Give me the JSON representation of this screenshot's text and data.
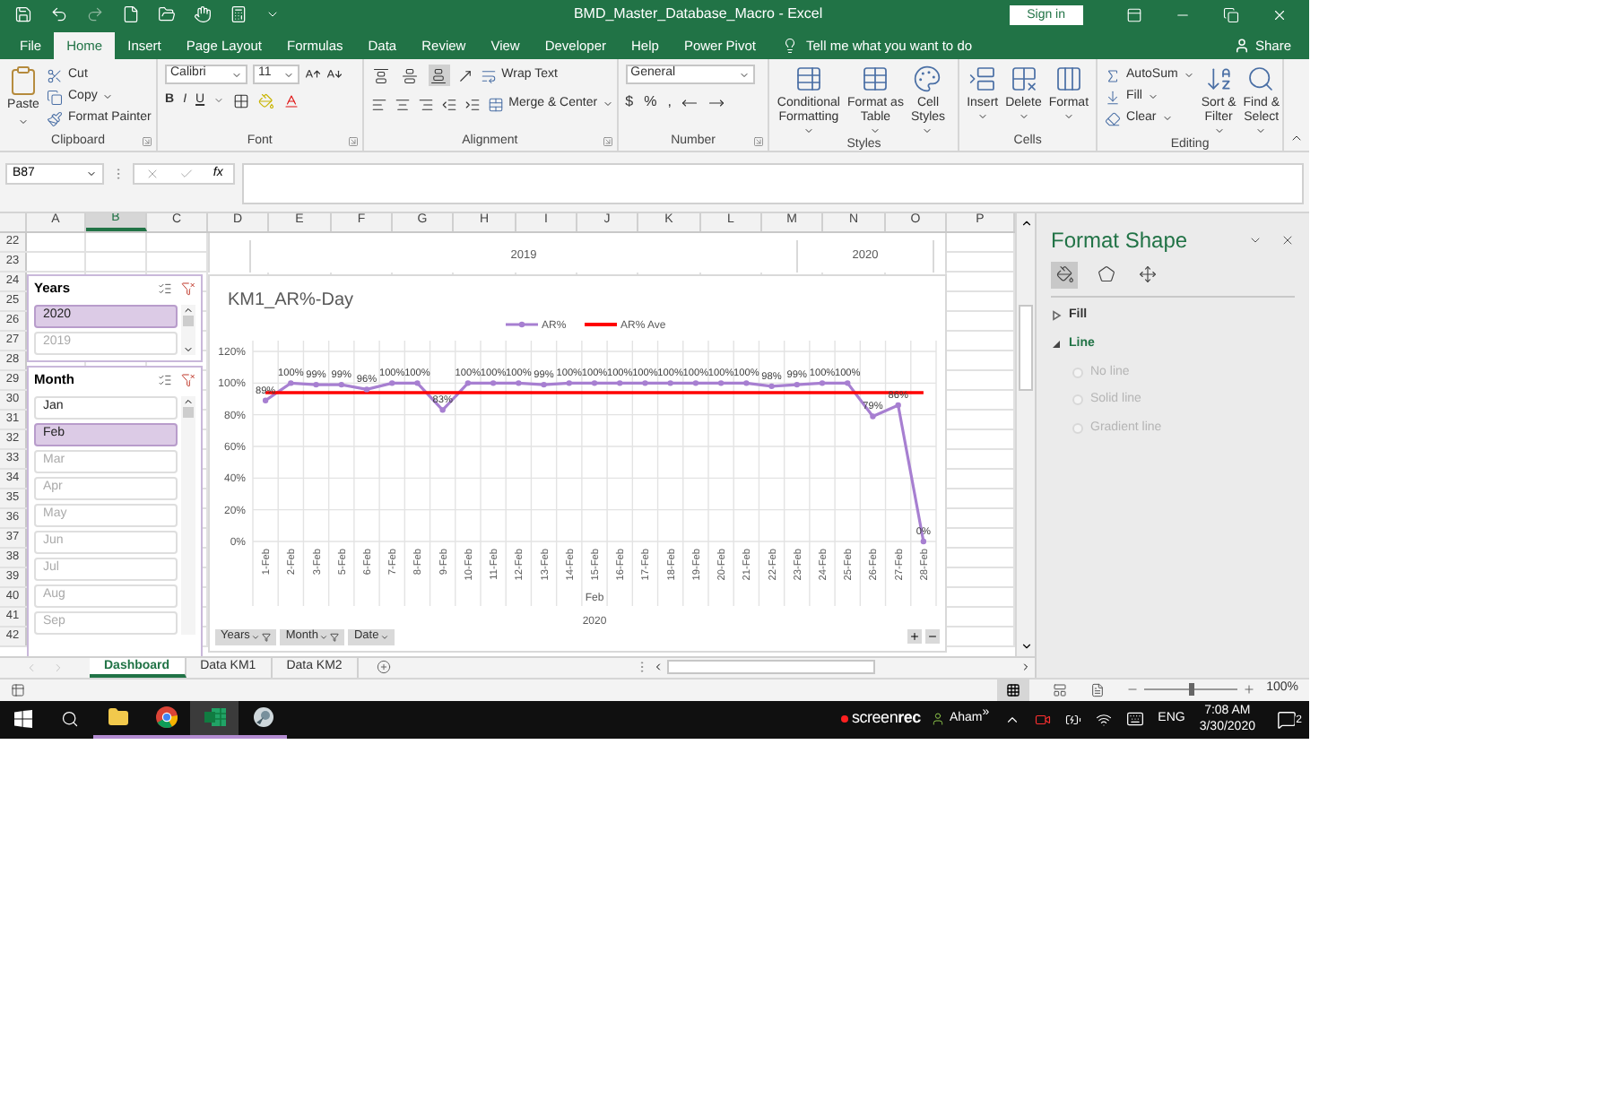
{
  "title_bar": {
    "title": "BMD_Master_Database_Macro - Excel",
    "sign_in": "Sign in"
  },
  "ribbon_tabs": [
    {
      "label": "File",
      "selected": false
    },
    {
      "label": "Home",
      "selected": true
    },
    {
      "label": "Insert",
      "selected": false
    },
    {
      "label": "Page Layout",
      "selected": false
    },
    {
      "label": "Formulas",
      "selected": false
    },
    {
      "label": "Data",
      "selected": false
    },
    {
      "label": "Review",
      "selected": false
    },
    {
      "label": "View",
      "selected": false
    },
    {
      "label": "Developer",
      "selected": false
    },
    {
      "label": "Help",
      "selected": false
    },
    {
      "label": "Power Pivot",
      "selected": false
    }
  ],
  "tell_me": "Tell me what you want to do",
  "share": "Share",
  "ribbon": {
    "clipboard": {
      "name": "Clipboard",
      "paste": "Paste",
      "cut": "Cut",
      "copy": "Copy",
      "format_painter": "Format Painter"
    },
    "font": {
      "name": "Font",
      "family": "Calibri",
      "size": "11",
      "bold": "B",
      "italic": "I",
      "underline": "U"
    },
    "alignment": {
      "name": "Alignment",
      "wrap_text": "Wrap Text",
      "merge_center": "Merge & Center",
      "valign_buttons": [
        {
          "kind": "top",
          "selected": false
        },
        {
          "kind": "middle",
          "selected": false
        },
        {
          "kind": "bottom",
          "selected": true
        }
      ]
    },
    "number": {
      "name": "Number",
      "format": "General",
      "currency": "$",
      "percent": "%",
      "comma": ","
    },
    "styles": {
      "name": "Styles",
      "buttons": [
        {
          "kind": "conditional",
          "lines": [
            "Conditional",
            "Formatting"
          ]
        },
        {
          "kind": "table",
          "lines": [
            "Format as",
            "Table"
          ]
        },
        {
          "kind": "cell_styles",
          "lines": [
            "Cell",
            "Styles"
          ]
        }
      ]
    },
    "cells": {
      "name": "Cells",
      "buttons": [
        {
          "kind": "insert",
          "lines": [
            "Insert"
          ]
        },
        {
          "kind": "delete",
          "lines": [
            "Delete"
          ]
        },
        {
          "kind": "format",
          "lines": [
            "Format"
          ]
        }
      ]
    },
    "editing": {
      "name": "Editing",
      "autosum": "AutoSum",
      "fill": "Fill",
      "clear": "Clear",
      "buttons": [
        {
          "kind": "sort",
          "lines": [
            "Sort &",
            "Filter"
          ]
        },
        {
          "kind": "find",
          "lines": [
            "Find &",
            "Select"
          ]
        }
      ]
    }
  },
  "formula_bar": {
    "name_box": "B87",
    "function_button": "fx"
  },
  "columns": [
    {
      "label": "A",
      "selected": false
    },
    {
      "label": "B",
      "selected": true
    },
    {
      "label": "C",
      "selected": false
    },
    {
      "label": "D",
      "selected": false
    },
    {
      "label": "E",
      "selected": false
    },
    {
      "label": "F",
      "selected": false
    },
    {
      "label": "G",
      "selected": false
    },
    {
      "label": "H",
      "selected": false
    },
    {
      "label": "I",
      "selected": false
    },
    {
      "label": "J",
      "selected": false
    },
    {
      "label": "K",
      "selected": false
    },
    {
      "label": "L",
      "selected": false
    },
    {
      "label": "M",
      "selected": false
    },
    {
      "label": "N",
      "selected": false
    },
    {
      "label": "O",
      "selected": false
    },
    {
      "label": "P",
      "selected": false
    }
  ],
  "rows": [
    "22",
    "23",
    "24",
    "25",
    "26",
    "27",
    "28",
    "29",
    "30",
    "31",
    "32",
    "33",
    "34",
    "35",
    "36",
    "37",
    "38",
    "39",
    "40",
    "41",
    "42"
  ],
  "chart_fragment": {
    "labels": [
      "2019",
      "2020"
    ]
  },
  "slicers": [
    {
      "title": "Years",
      "items": [
        {
          "label": "2020",
          "selected": true,
          "has_data": true
        },
        {
          "label": "2019",
          "selected": false,
          "has_data": false
        }
      ]
    },
    {
      "title": "Month",
      "items": [
        {
          "label": "Jan",
          "selected": false,
          "has_data": true
        },
        {
          "label": "Feb",
          "selected": true,
          "has_data": true
        },
        {
          "label": "Mar",
          "selected": false,
          "has_data": false
        },
        {
          "label": "Apr",
          "selected": false,
          "has_data": false
        },
        {
          "label": "May",
          "selected": false,
          "has_data": false
        },
        {
          "label": "Jun",
          "selected": false,
          "has_data": false
        },
        {
          "label": "Jul",
          "selected": false,
          "has_data": false
        },
        {
          "label": "Aug",
          "selected": false,
          "has_data": false
        },
        {
          "label": "Sep",
          "selected": false,
          "has_data": false
        }
      ]
    }
  ],
  "chart": {
    "chart_data": {
      "type": "line",
      "title": "KM1_AR%-Day",
      "xlabel": "Feb",
      "categories": [
        "1-Feb",
        "2-Feb",
        "3-Feb",
        "5-Feb",
        "6-Feb",
        "7-Feb",
        "8-Feb",
        "9-Feb",
        "10-Feb",
        "11-Feb",
        "12-Feb",
        "13-Feb",
        "14-Feb",
        "15-Feb",
        "16-Feb",
        "17-Feb",
        "18-Feb",
        "19-Feb",
        "20-Feb",
        "21-Feb",
        "22-Feb",
        "23-Feb",
        "24-Feb",
        "25-Feb",
        "26-Feb",
        "27-Feb",
        "28-Feb"
      ],
      "grid": true,
      "legend": "top",
      "series": [
        {
          "name": "AR%",
          "color": "#a77fd1",
          "marker": "circle",
          "values": [
            89,
            100,
            99,
            99,
            96,
            100,
            100,
            83,
            100,
            100,
            100,
            99,
            100,
            100,
            100,
            100,
            100,
            100,
            100,
            100,
            98,
            99,
            100,
            100,
            79,
            86,
            0
          ]
        },
        {
          "name": "AR% Ave",
          "color": "#ff0000",
          "values": [
            94,
            94,
            94,
            94,
            94,
            94,
            94,
            94,
            94,
            94,
            94,
            94,
            94,
            94,
            94,
            94,
            94,
            94,
            94,
            94,
            94,
            94,
            94,
            94,
            94,
            94,
            94
          ]
        }
      ],
      "ylim": [
        0,
        120
      ],
      "yticks": [
        {
          "value": 0,
          "label": "0%"
        },
        {
          "value": 20,
          "label": "20%"
        },
        {
          "value": 40,
          "label": "40%"
        },
        {
          "value": 60,
          "label": "60%"
        },
        {
          "value": 80,
          "label": "80%"
        },
        {
          "value": 100,
          "label": "100%"
        },
        {
          "value": 120,
          "label": "120%"
        }
      ],
      "value_labels": [
        "89%",
        "100%",
        "99%",
        "99%",
        "96%",
        "100%",
        "100%",
        "83%",
        "100%",
        "100%",
        "100%",
        "99%",
        "100%",
        "100%",
        "100%",
        "100%",
        "100%",
        "100%",
        "100%",
        "100%",
        "98%",
        "99%",
        "100%",
        "100%",
        "79%",
        "86%",
        "0%"
      ]
    },
    "axis_group": "2020",
    "field_buttons": [
      {
        "label": "Years",
        "filtered": true
      },
      {
        "label": "Month",
        "filtered": true
      },
      {
        "label": "Date",
        "filtered": false
      }
    ]
  },
  "format_pane": {
    "title": "Format Shape",
    "icon_tabs": [
      {
        "kind": "fill",
        "selected": true
      },
      {
        "kind": "effects",
        "selected": false
      },
      {
        "kind": "size",
        "selected": false
      }
    ],
    "sections": [
      {
        "label": "Fill",
        "expanded": false
      },
      {
        "label": "Line",
        "expanded": true,
        "options": [
          {
            "label": "No line",
            "selected": false,
            "disabled": true
          },
          {
            "label": "Solid line",
            "selected": false,
            "disabled": true
          },
          {
            "label": "Gradient line",
            "selected": false,
            "disabled": true
          }
        ]
      }
    ]
  },
  "sheet_tabs": [
    {
      "label": "Dashboard",
      "selected": true
    },
    {
      "label": "Data KM1",
      "selected": false
    },
    {
      "label": "Data KM2",
      "selected": false
    }
  ],
  "status_bar": {
    "zoom": {
      "level": 0.5,
      "reading": "100%"
    }
  },
  "taskbar": {
    "apps": [
      {
        "kind": "explorer",
        "active": false
      },
      {
        "kind": "chrome",
        "active": false
      },
      {
        "kind": "excel",
        "active": true
      },
      {
        "kind": "app",
        "active": false
      }
    ],
    "recorder": "screen**rec**",
    "user": "Aham",
    "overflow": "»",
    "language": "ENG",
    "time": "7:08 AM",
    "date": "3/30/2020",
    "notifications": "2"
  }
}
